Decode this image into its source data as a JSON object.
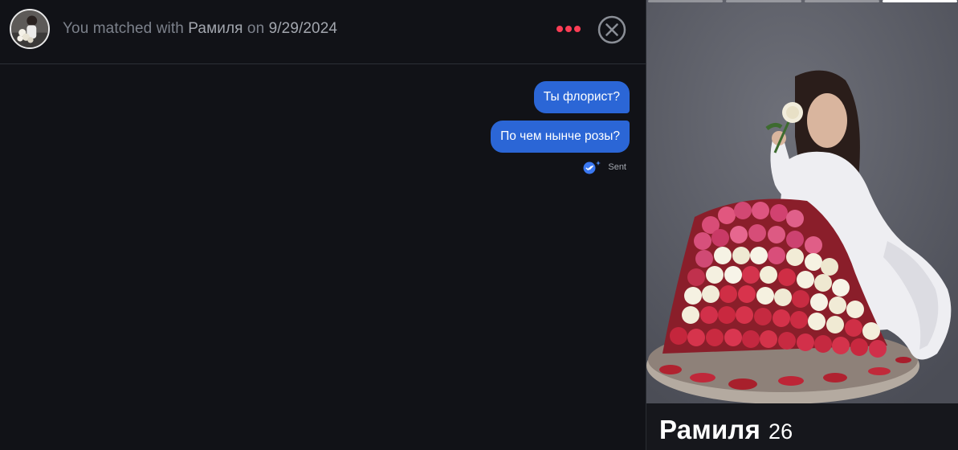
{
  "header": {
    "match_prefix": "You matched with ",
    "match_name": "Рамиля",
    "match_on": " on ",
    "match_date": "9/29/2024",
    "avatar_icon": "avatar-photo",
    "more_icon": "more-dots-icon",
    "close_icon": "close-circle-icon"
  },
  "messages": [
    {
      "text": "Ты флорист?"
    },
    {
      "text": "По чем нынче розы?"
    }
  ],
  "status": {
    "label": "Sent",
    "icon": "sent-check-icon"
  },
  "profile": {
    "name": "Рамиля",
    "age": "26",
    "photo_icon": "profile-photo"
  },
  "colors": {
    "accent": "#fd3d55",
    "bubble": "#2b66d6",
    "background": "#111217"
  }
}
